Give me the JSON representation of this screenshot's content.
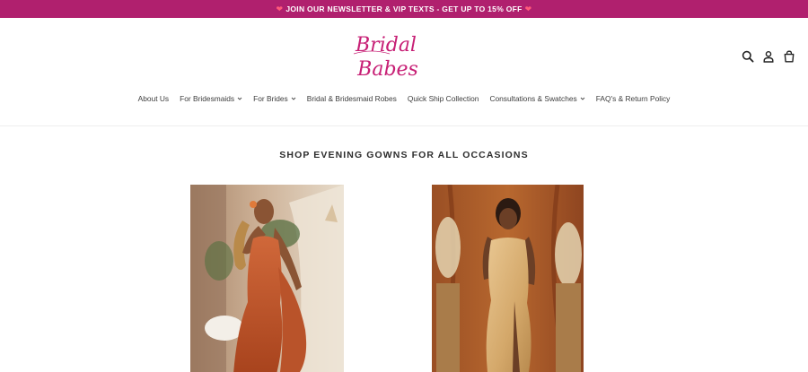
{
  "announcement": {
    "text": "JOIN OUR NEWSLETTER & VIP TEXTS - GET UP TO 15% OFF",
    "left_icon": "heart-icon",
    "right_icon": "heart-icon"
  },
  "brand": {
    "line1": "Bridal",
    "line2": "Babes",
    "color": "#c71f75"
  },
  "header_icons": [
    "search-icon",
    "account-icon",
    "cart-icon"
  ],
  "nav": {
    "items": [
      {
        "label": "About Us",
        "has_dropdown": false
      },
      {
        "label": "For Bridesmaids",
        "has_dropdown": true
      },
      {
        "label": "For Brides",
        "has_dropdown": true
      },
      {
        "label": "Bridal & Bridesmaid Robes",
        "has_dropdown": false
      },
      {
        "label": "Quick Ship Collection",
        "has_dropdown": false
      },
      {
        "label": "Consultations & Swatches",
        "has_dropdown": true
      },
      {
        "label": "FAQ's & Return Policy",
        "has_dropdown": false
      }
    ]
  },
  "section": {
    "title": "SHOP EVENING GOWNS FOR ALL OCCASIONS"
  },
  "colors": {
    "announcement_bg": "#b0206e",
    "brand_pink": "#c71f75",
    "gown_1": "#c2552a",
    "gown_2": "#d9b27a"
  }
}
